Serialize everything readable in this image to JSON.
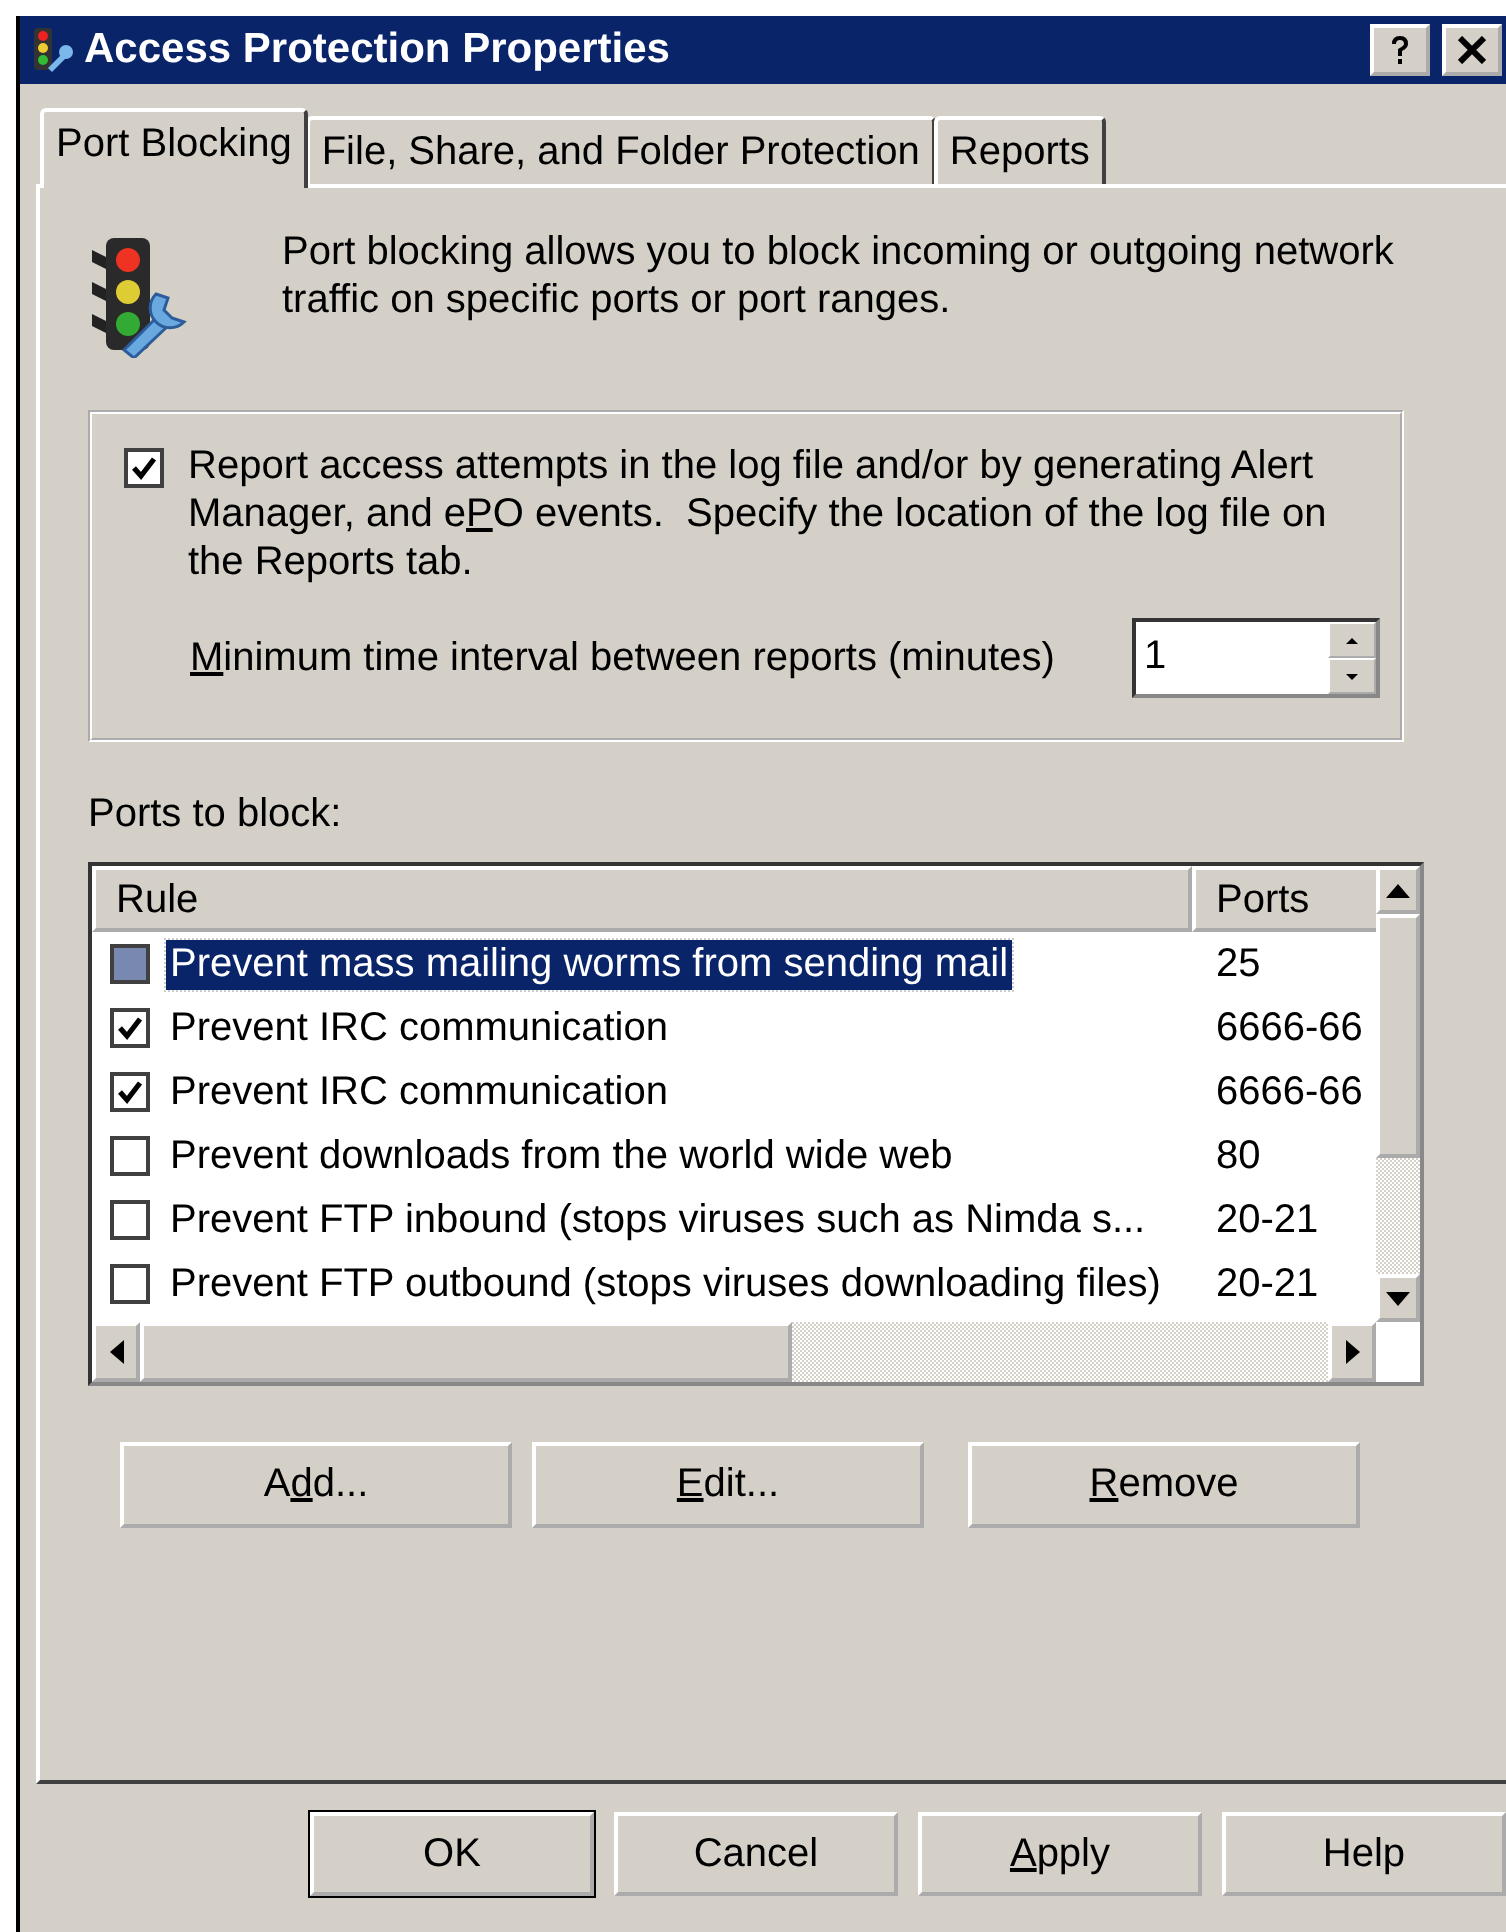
{
  "window": {
    "title": "Access Protection Properties"
  },
  "tabs": [
    {
      "label": "Port Blocking",
      "selected": true
    },
    {
      "label": "File, Share, and Folder Protection",
      "selected": false
    },
    {
      "label": "Reports",
      "selected": false
    }
  ],
  "description": "Port blocking allows you to block incoming or outgoing network traffic on specific ports or port ranges.",
  "report_option": {
    "checked": true,
    "label_parts": [
      {
        "text": "Report access attempts in the log file and/or by generating Alert Manager, and e",
        "underlined": false
      },
      {
        "text": "P",
        "underlined": true
      },
      {
        "text": "O events.  Specify the location of the log file on the Reports tab.",
        "underlined": false
      }
    ]
  },
  "interval": {
    "label_parts": [
      {
        "text": "M",
        "underlined": true
      },
      {
        "text": "inimum time interval between reports (minutes)",
        "underlined": false
      }
    ],
    "value": "1"
  },
  "ports_label": "Ports to block:",
  "table": {
    "columns": [
      "Rule",
      "Ports"
    ],
    "rows": [
      {
        "rule": "Prevent mass mailing worms from sending mail",
        "ports": "25",
        "checked": false,
        "selected": true
      },
      {
        "rule": "Prevent IRC communication",
        "ports": "6666-66",
        "checked": true,
        "selected": false
      },
      {
        "rule": "Prevent IRC communication",
        "ports": "6666-66",
        "checked": true,
        "selected": false
      },
      {
        "rule": "Prevent downloads from the world wide web",
        "ports": "80",
        "checked": false,
        "selected": false
      },
      {
        "rule": "Prevent FTP inbound  (stops viruses such as Nimda s...",
        "ports": "20-21",
        "checked": false,
        "selected": false
      },
      {
        "rule": "Prevent FTP outbound (stops viruses downloading files)",
        "ports": "20-21",
        "checked": false,
        "selected": false
      }
    ]
  },
  "list_buttons": [
    {
      "label_parts": [
        {
          "text": "A",
          "underlined": false
        },
        {
          "text": "d",
          "underlined": true
        },
        {
          "text": "d...",
          "underlined": false
        }
      ]
    },
    {
      "label_parts": [
        {
          "text": "E",
          "underlined": true
        },
        {
          "text": "dit...",
          "underlined": false
        }
      ]
    },
    {
      "label_parts": [
        {
          "text": "R",
          "underlined": true
        },
        {
          "text": "emove",
          "underlined": false
        }
      ]
    }
  ],
  "dialog_buttons": [
    {
      "label_parts": [
        {
          "text": "OK",
          "underlined": false
        }
      ],
      "default": true
    },
    {
      "label_parts": [
        {
          "text": "Cancel",
          "underlined": false
        }
      ],
      "default": false
    },
    {
      "label_parts": [
        {
          "text": "A",
          "underlined": true
        },
        {
          "text": "pply",
          "underlined": false
        }
      ],
      "default": false
    },
    {
      "label_parts": [
        {
          "text": "Help",
          "underlined": false
        }
      ],
      "default": false
    }
  ]
}
